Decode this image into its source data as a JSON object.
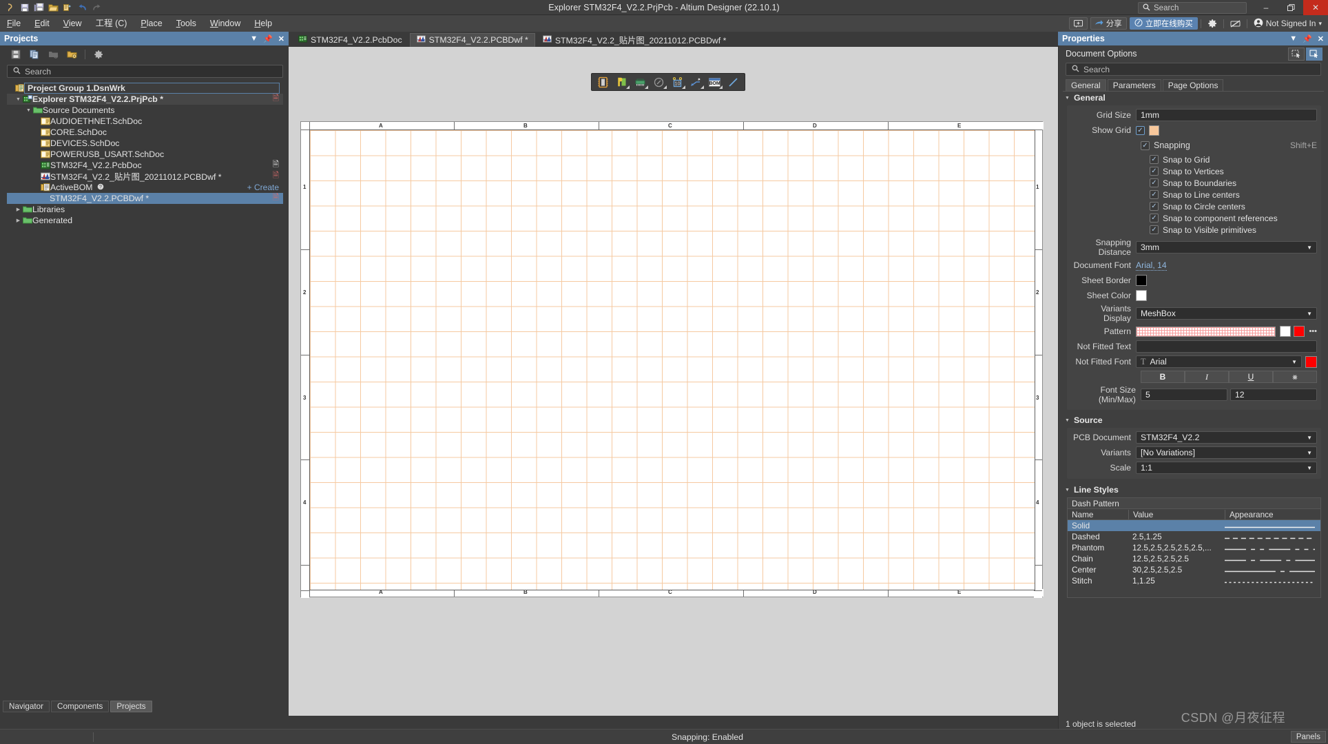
{
  "window": {
    "title": "Explorer STM32F4_V2.2.PrjPcb - Altium Designer (22.10.1)",
    "search_placeholder": "Search",
    "minimize": "–",
    "maximize": "❐",
    "close": "✕"
  },
  "quick_access": [
    {
      "name": "altium-logo-icon",
      "glyph": "ɔ"
    },
    {
      "name": "save-icon",
      "glyph": "ὋE"
    },
    {
      "name": "save-all-icon",
      "glyph": "ὋE"
    },
    {
      "name": "open-icon",
      "glyph": "Ὄ2"
    },
    {
      "name": "open-project-icon",
      "glyph": "Ὄ1"
    },
    {
      "name": "undo-icon",
      "glyph": "↶"
    },
    {
      "name": "redo-icon",
      "glyph": "↷"
    }
  ],
  "menu": {
    "items": [
      {
        "label": "File",
        "accel": "F"
      },
      {
        "label": "Edit",
        "accel": "E"
      },
      {
        "label": "View",
        "accel": "V"
      },
      {
        "label": "工程 (C)",
        "accel": ""
      },
      {
        "label": "Place",
        "accel": "P"
      },
      {
        "label": "Tools",
        "accel": "T"
      },
      {
        "label": "Window",
        "accel": "W"
      },
      {
        "label": "Help",
        "accel": "H"
      }
    ],
    "right": {
      "feedback_icon": "⬜",
      "share_label": "分享",
      "buy_label": "立即在线购买",
      "settings_icon": "⚙",
      "extensions_icon": "⬚",
      "account_label": "Not Signed In",
      "account_caret": "▾"
    }
  },
  "projects_panel": {
    "title": "Projects",
    "header_icons": [
      "chevron-down-icon",
      "pin-icon",
      "close-icon"
    ],
    "toolbar_icons": [
      "save-icon",
      "copy-icon",
      "open-folder-icon",
      "project-options-icon",
      "gear-icon"
    ],
    "search_placeholder": "Search",
    "tree": [
      {
        "label": "Project Group 1.DsnWrk",
        "indent": 0,
        "icon": "workspace-icon",
        "bold": true,
        "state": "outlined",
        "badge": ""
      },
      {
        "label": "Explorer STM32F4_V2.2.PrjPcb *",
        "indent": 1,
        "icon": "pcb-project-icon",
        "bold": true,
        "expander": "down",
        "state": "highlight",
        "badge": "red-doc"
      },
      {
        "label": "Source Documents",
        "indent": 2,
        "icon": "folder-icon",
        "bold": false,
        "expander": "down",
        "state": "",
        "badge": ""
      },
      {
        "label": "AUDIOETHNET.SchDoc",
        "indent": 3,
        "icon": "sch-icon",
        "bold": false,
        "state": "",
        "badge": ""
      },
      {
        "label": "CORE.SchDoc",
        "indent": 3,
        "icon": "sch-icon",
        "bold": false,
        "state": "",
        "badge": ""
      },
      {
        "label": "DEVICES.SchDoc",
        "indent": 3,
        "icon": "sch-icon",
        "bold": false,
        "state": "",
        "badge": ""
      },
      {
        "label": "POWERUSB_USART.SchDoc",
        "indent": 3,
        "icon": "sch-icon",
        "bold": false,
        "state": "",
        "badge": ""
      },
      {
        "label": "STM32F4_V2.2.PcbDoc",
        "indent": 3,
        "icon": "pcb-icon",
        "bold": false,
        "state": "",
        "badge": "white-doc"
      },
      {
        "label": "STM32F4_V2.2_贴片图_20211012.PCBDwf *",
        "indent": 3,
        "icon": "draftsman-icon",
        "bold": false,
        "state": "",
        "badge": "red-doc"
      },
      {
        "label": "ActiveBOM",
        "indent": 3,
        "icon": "bom-icon",
        "bold": false,
        "state": "",
        "badge": "",
        "help": "?",
        "action": "+ Create"
      },
      {
        "label": "STM32F4_V2.2.PCBDwf *",
        "indent": 4,
        "icon": "none",
        "bold": false,
        "state": "selected",
        "badge": "red-doc"
      },
      {
        "label": "Libraries",
        "indent": 1,
        "icon": "folder-icon",
        "bold": false,
        "expander": "right",
        "state": "",
        "badge": ""
      },
      {
        "label": "Generated",
        "indent": 1,
        "icon": "folder-icon",
        "bold": false,
        "expander": "right",
        "state": "",
        "badge": ""
      }
    ],
    "bottom_tabs": [
      {
        "label": "Navigator",
        "active": false
      },
      {
        "label": "Components",
        "active": false
      },
      {
        "label": "Projects",
        "active": true
      }
    ]
  },
  "document_tabs": [
    {
      "label": "STM32F4_V2.2.PcbDoc",
      "icon": "pcb-icon",
      "active": false
    },
    {
      "label": "STM32F4_V2.2.PCBDwf *",
      "icon": "draftsman-icon",
      "active": true
    },
    {
      "label": "STM32F4_V2.2_贴片图_20211012.PCBDwf *",
      "icon": "draftsman-icon",
      "active": false
    }
  ],
  "floating_toolbar": [
    {
      "name": "board-view-icon",
      "glyph": "▣"
    },
    {
      "name": "board-assembly-icon",
      "glyph": "P"
    },
    {
      "name": "board-fabrication-icon",
      "glyph": "▓"
    },
    {
      "name": "drill-table-icon",
      "glyph": "○"
    },
    {
      "name": "dimension-icon",
      "glyph": "10"
    },
    {
      "name": "callout-icon",
      "glyph": "↙"
    },
    {
      "name": "bom-table-icon",
      "glyph": "BOM"
    },
    {
      "name": "line-icon",
      "glyph": "╱"
    }
  ],
  "canvas": {
    "ruler_labels_h": [
      "A",
      "B",
      "C",
      "D",
      "E"
    ],
    "ruler_labels_v": [
      "1",
      "2",
      "3",
      "4"
    ],
    "grid_color": "#f6c9a0",
    "sheet_color": "#ffffff"
  },
  "properties": {
    "title": "Properties",
    "header_icons": [
      "chevron-down-icon",
      "pin-icon",
      "close-icon"
    ],
    "object_label": "Document Options",
    "search_placeholder": "Search",
    "tabs": [
      {
        "label": "General",
        "active": true
      },
      {
        "label": "Parameters",
        "active": false
      },
      {
        "label": "Page Options",
        "active": false
      }
    ],
    "general": {
      "heading": "General",
      "grid_size_label": "Grid Size",
      "grid_size_value": "1mm",
      "show_grid_label": "Show Grid",
      "show_grid_checked": true,
      "grid_color": "#f7c79b",
      "snapping_label": "Snapping",
      "snapping_shortcut": "Shift+E",
      "snapping_checked": true,
      "snap_options": [
        {
          "label": "Snap to Grid",
          "checked": true
        },
        {
          "label": "Snap to Vertices",
          "checked": true
        },
        {
          "label": "Snap to Boundaries",
          "checked": true
        },
        {
          "label": "Snap to Line centers",
          "checked": true
        },
        {
          "label": "Snap to Circle centers",
          "checked": true
        },
        {
          "label": "Snap to component references",
          "checked": true
        },
        {
          "label": "Snap to Visible primitives",
          "checked": true
        }
      ],
      "snapping_distance_label": "Snapping Distance",
      "snapping_distance_value": "3mm",
      "document_font_label": "Document Font",
      "document_font_value": "Arial, 14",
      "sheet_border_label": "Sheet Border",
      "sheet_border_color": "#000000",
      "sheet_color_label": "Sheet Color",
      "sheet_color_value": "#ffffff",
      "variants_display_label": "Variants Display",
      "variants_display_value": "MeshBox",
      "pattern_label": "Pattern",
      "pattern_color_a": "#ffffff",
      "pattern_color_b": "#ff0000",
      "pattern_more": "•••",
      "not_fitted_text_label": "Not Fitted Text",
      "not_fitted_text_value": "",
      "not_fitted_font_label": "Not Fitted Font",
      "not_fitted_font_value": "Arial",
      "not_fitted_font_color": "#ff0000",
      "style_buttons": [
        {
          "label": "B",
          "name": "bold-button"
        },
        {
          "label": "I",
          "name": "italic-button"
        },
        {
          "label": "U",
          "name": "underline-button"
        },
        {
          "label": "⨳",
          "name": "strikethrough-button"
        }
      ],
      "font_size_label": "Font Size (Min/Max)",
      "font_size_min": "5",
      "font_size_max": "12"
    },
    "source": {
      "heading": "Source",
      "pcb_document_label": "PCB Document",
      "pcb_document_value": "STM32F4_V2.2",
      "variants_label": "Variants",
      "variants_value": "[No Variations]",
      "scale_label": "Scale",
      "scale_value": "1:1"
    },
    "line_styles": {
      "heading": "Line Styles",
      "group_title": "Dash Pattern",
      "columns": [
        "Name",
        "Value",
        "Appearance"
      ],
      "rows": [
        {
          "name": "Solid",
          "value": "",
          "appearance": "solid",
          "selected": true
        },
        {
          "name": "Dashed",
          "value": "2.5,1.25",
          "appearance": "dashed",
          "selected": false
        },
        {
          "name": "Phantom",
          "value": "12.5,2.5,2.5,2.5,2.5,...",
          "appearance": "phantom",
          "selected": false
        },
        {
          "name": "Chain",
          "value": "12.5,2.5,2.5,2.5",
          "appearance": "chain",
          "selected": false
        },
        {
          "name": "Center",
          "value": "30,2.5,2.5,2.5",
          "appearance": "center",
          "selected": false
        },
        {
          "name": "Stitch",
          "value": "1,1.25",
          "appearance": "stitch",
          "selected": false
        }
      ]
    },
    "status": "1 object is selected"
  },
  "statusbar": {
    "snapping": "Snapping: Enabled",
    "panels_label": "Panels",
    "watermark": "CSDN @月夜征程"
  }
}
